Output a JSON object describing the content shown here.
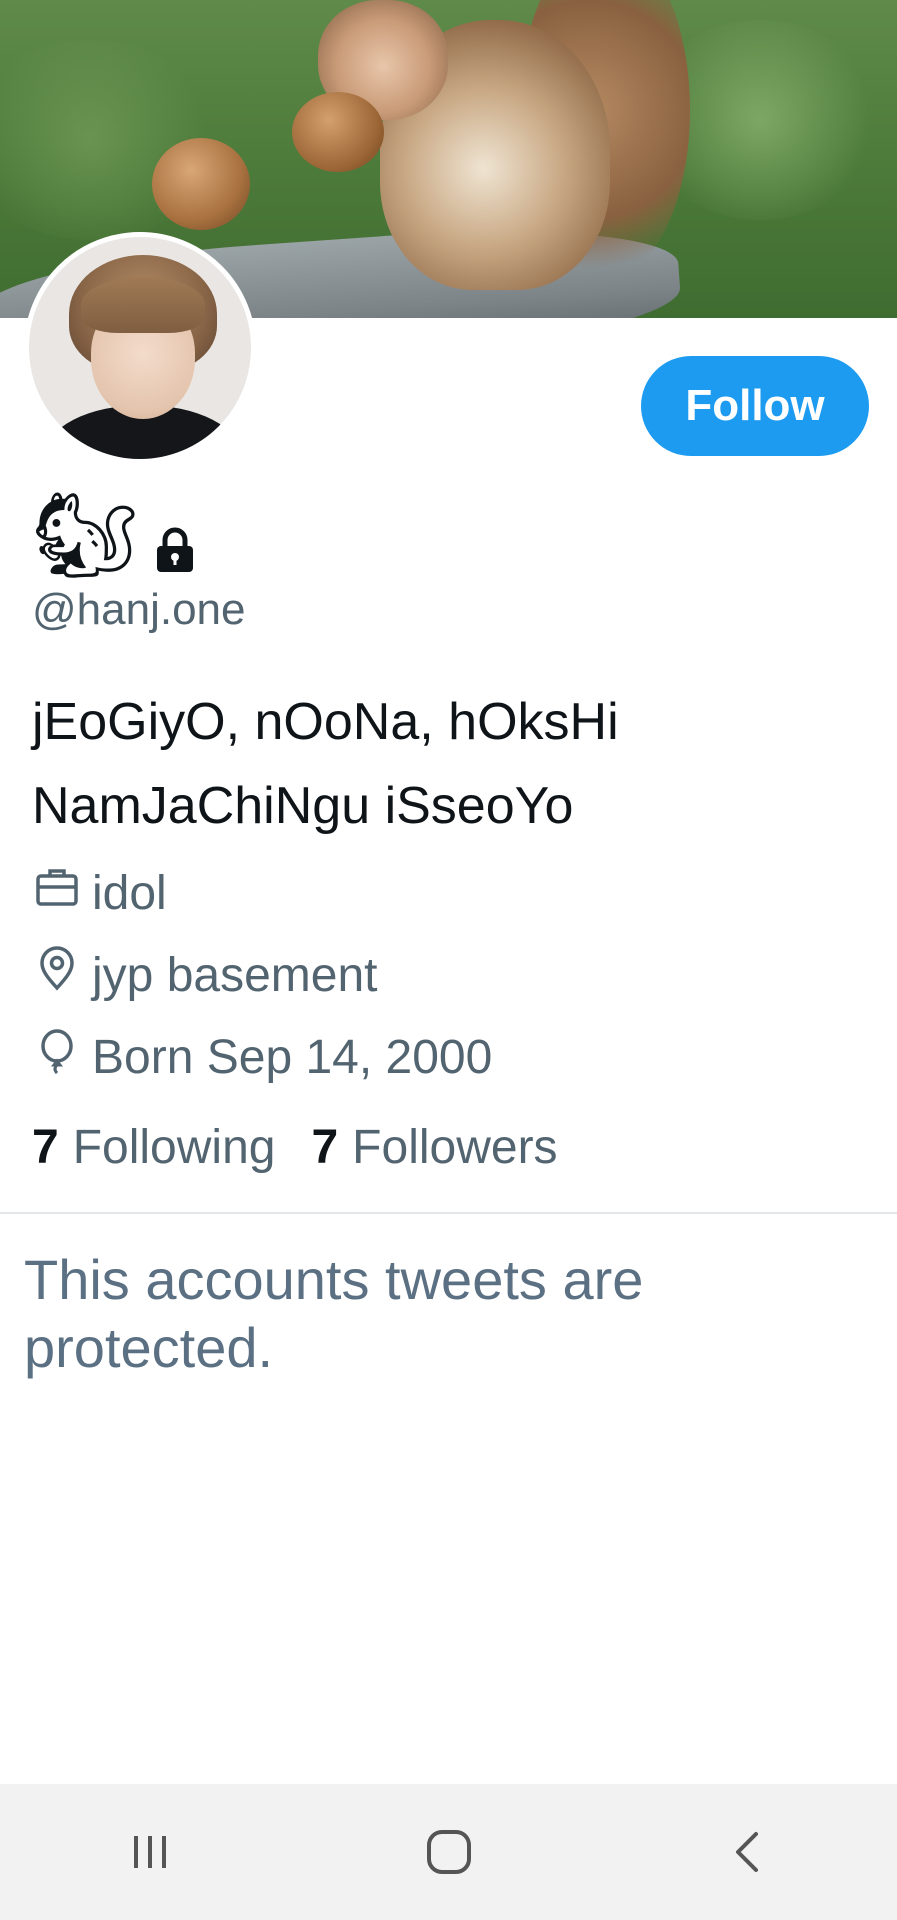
{
  "profile": {
    "display_name": "🐿",
    "handle": "@hanj.one",
    "bio": "jEoGiyO, nOoNa, hOksHi NamJaChiNgu iSseoYo",
    "follow_label": "Follow",
    "protected": true
  },
  "meta": {
    "job_icon": "briefcase-icon",
    "job": "idol",
    "location_icon": "location-pin-icon",
    "location": "jyp basement",
    "birthday_icon": "balloon-icon",
    "birthday": "Born Sep 14, 2000"
  },
  "stats": {
    "following_count": "7",
    "following_label": "Following",
    "followers_count": "7",
    "followers_label": "Followers"
  },
  "protected_message": "This accounts tweets are protected.",
  "navigation": {
    "recents_icon": "recent-apps-icon",
    "home_icon": "home-icon",
    "back_icon": "back-icon"
  },
  "colors": {
    "accent": "#1d9bf0",
    "secondary_text": "#536471",
    "protected_text": "#5b7083"
  }
}
